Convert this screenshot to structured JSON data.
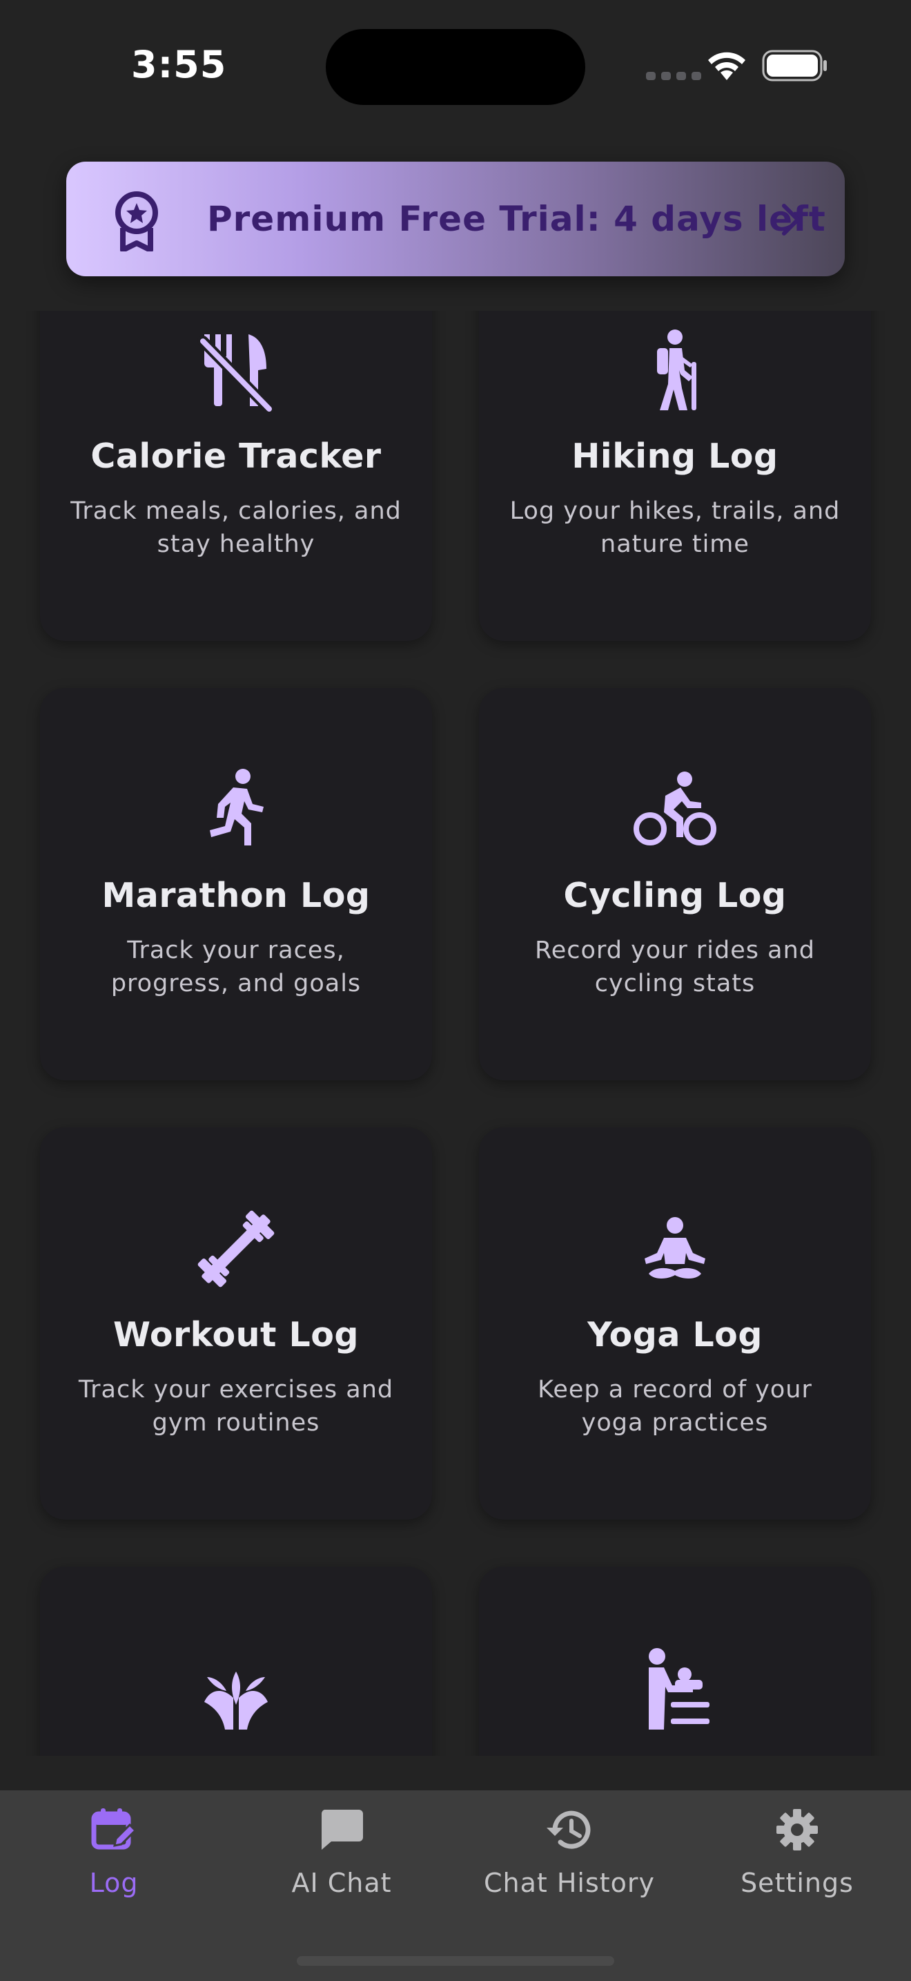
{
  "status_bar": {
    "time": "3:55"
  },
  "premium_banner": {
    "text": "Premium Free Trial: 4 days left",
    "icon": "award-icon",
    "chevron": "chevron-right-icon"
  },
  "colors": {
    "accent": "#9B6CF5",
    "icon_tint": "#D6BFFF",
    "card_bg": "#1E1D21",
    "page_bg": "#232323",
    "nav_bg": "#3D3D3D"
  },
  "cards": [
    {
      "title": "Calorie Tracker",
      "description": "Track meals, calories, and stay healthy",
      "icon": "no-food-icon"
    },
    {
      "title": "Hiking Log",
      "description": "Log your hikes, trails, and nature time",
      "icon": "hiking-icon"
    },
    {
      "title": "Marathon Log",
      "description": "Track your races, progress, and goals",
      "icon": "running-icon"
    },
    {
      "title": "Cycling Log",
      "description": "Record your rides and cycling stats",
      "icon": "bicycle-icon"
    },
    {
      "title": "Workout Log",
      "description": "Track your exercises and gym routines",
      "icon": "dumbbell-icon"
    },
    {
      "title": "Yoga Log",
      "description": "Keep a record of your yoga practices",
      "icon": "meditation-icon"
    },
    {
      "title": "",
      "description": "",
      "icon": "plant-icon"
    },
    {
      "title": "",
      "description": "",
      "icon": "baby-changing-icon"
    }
  ],
  "bottom_nav": {
    "items": [
      {
        "label": "Log",
        "icon": "calendar-edit-icon",
        "active": true
      },
      {
        "label": "AI Chat",
        "icon": "chat-bubble-icon",
        "active": false
      },
      {
        "label": "Chat History",
        "icon": "history-icon",
        "active": false
      },
      {
        "label": "Settings",
        "icon": "gear-icon",
        "active": false
      }
    ]
  }
}
